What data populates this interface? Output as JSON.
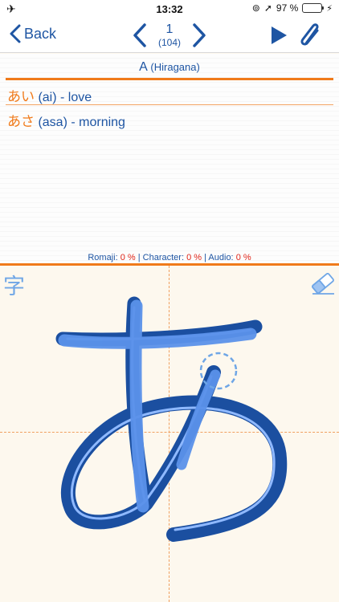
{
  "status": {
    "time": "13:32",
    "battery": "97 %"
  },
  "nav": {
    "back_label": "Back",
    "current": "1",
    "total": "(104)"
  },
  "card": {
    "char_name": "A",
    "char_type": "(Hiragana)",
    "vocab": [
      {
        "jp": "あい",
        "romaji": "(ai)",
        "meaning": "- love"
      },
      {
        "jp": "あさ",
        "romaji": "(asa)",
        "meaning": "- morning"
      }
    ]
  },
  "scores": {
    "romaji_label": "Romaji:",
    "romaji": "0 %",
    "character_label": "Character:",
    "character": "0 %",
    "audio_label": "Audio:",
    "audio": "0 %"
  },
  "draw": {
    "kanji_toggle": "字"
  },
  "colors": {
    "accent": "#1e55a3",
    "orange": "#f07a1a",
    "red": "#e0261a",
    "stroke": "#5b92ea"
  }
}
